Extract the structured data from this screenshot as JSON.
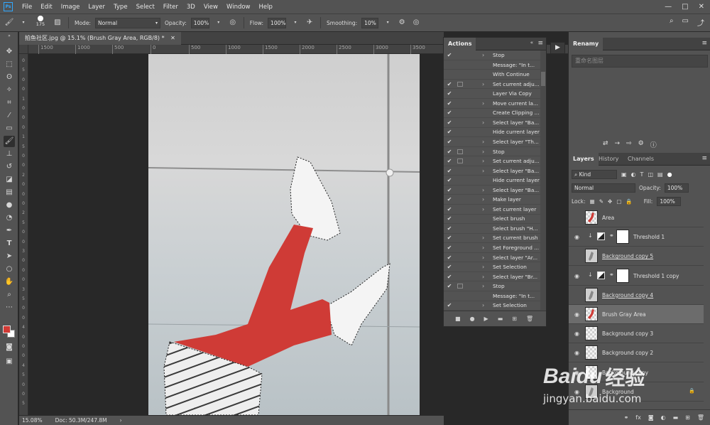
{
  "app": {
    "logo": "Ps"
  },
  "menu": [
    "File",
    "Edit",
    "Image",
    "Layer",
    "Type",
    "Select",
    "Filter",
    "3D",
    "View",
    "Window",
    "Help"
  ],
  "window_controls": {
    "min": "—",
    "max": "□",
    "close": "✕"
  },
  "options_bar": {
    "brush_size": "175",
    "mode_label": "Mode:",
    "mode_value": "Normal",
    "opacity_label": "Opacity:",
    "opacity_value": "100%",
    "flow_label": "Flow:",
    "flow_value": "100%",
    "smoothing_label": "Smoothing:",
    "smoothing_value": "10%"
  },
  "document": {
    "tab_title": "拍鱼社区.jpg @ 15.1% (Brush Gray Area, RGB/8) *",
    "zoom": "15.08%",
    "doc_info": "Doc: 50.3M/247.8M"
  },
  "ruler_h": [
    "1500",
    "1000",
    "500",
    "0",
    "500",
    "1000",
    "1500",
    "2000",
    "2500",
    "3000",
    "3500"
  ],
  "ruler_v": [
    "0",
    "5",
    "0",
    "0",
    "1",
    "0",
    "0",
    "0",
    "1",
    "5",
    "0",
    "0",
    "2",
    "0",
    "0",
    "0",
    "2",
    "5",
    "0",
    "0",
    "3",
    "0",
    "0",
    "0",
    "3",
    "5",
    "0",
    "0",
    "4",
    "0",
    "0",
    "0",
    "4",
    "5",
    "0",
    "0",
    "5"
  ],
  "actions_panel": {
    "title": "Actions",
    "rows": [
      {
        "check": true,
        "dialog": false,
        "arrow": true,
        "label": "Stop"
      },
      {
        "check": false,
        "dialog": false,
        "arrow": false,
        "label": "Message:  \"In t..."
      },
      {
        "check": false,
        "dialog": false,
        "arrow": false,
        "label": "With Continue"
      },
      {
        "check": true,
        "dialog": true,
        "arrow": true,
        "label": "Set current adju..."
      },
      {
        "check": true,
        "dialog": false,
        "arrow": false,
        "label": "Layer Via Copy"
      },
      {
        "check": true,
        "dialog": false,
        "arrow": true,
        "label": "Move current la..."
      },
      {
        "check": true,
        "dialog": false,
        "arrow": false,
        "label": "Create Clipping ..."
      },
      {
        "check": true,
        "dialog": false,
        "arrow": true,
        "label": "Select layer \"Ba..."
      },
      {
        "check": true,
        "dialog": false,
        "arrow": false,
        "label": "Hide current layer"
      },
      {
        "check": true,
        "dialog": false,
        "arrow": true,
        "label": "Select layer \"Th..."
      },
      {
        "check": true,
        "dialog": true,
        "arrow": true,
        "label": "Stop"
      },
      {
        "check": true,
        "dialog": true,
        "arrow": true,
        "label": "Set current adju..."
      },
      {
        "check": true,
        "dialog": false,
        "arrow": true,
        "label": "Select layer \"Ba..."
      },
      {
        "check": true,
        "dialog": false,
        "arrow": false,
        "label": "Hide current layer"
      },
      {
        "check": true,
        "dialog": false,
        "arrow": true,
        "label": "Select layer \"Ba..."
      },
      {
        "check": true,
        "dialog": false,
        "arrow": true,
        "label": "Make layer"
      },
      {
        "check": true,
        "dialog": false,
        "arrow": true,
        "label": "Set current layer"
      },
      {
        "check": true,
        "dialog": false,
        "arrow": false,
        "label": "Select brush"
      },
      {
        "check": true,
        "dialog": false,
        "arrow": false,
        "label": "Select brush \"H..."
      },
      {
        "check": true,
        "dialog": false,
        "arrow": true,
        "label": "Set current brush"
      },
      {
        "check": true,
        "dialog": false,
        "arrow": true,
        "label": "Set Foreground ..."
      },
      {
        "check": true,
        "dialog": false,
        "arrow": true,
        "label": "Select layer \"Ar..."
      },
      {
        "check": true,
        "dialog": false,
        "arrow": true,
        "label": "Set Selection"
      },
      {
        "check": true,
        "dialog": false,
        "arrow": true,
        "label": "Select layer \"Br..."
      },
      {
        "check": true,
        "dialog": true,
        "arrow": true,
        "label": "Stop"
      },
      {
        "check": false,
        "dialog": false,
        "arrow": false,
        "label": "Message:  \"In t..."
      },
      {
        "check": true,
        "dialog": false,
        "arrow": true,
        "label": "Set Selection"
      }
    ]
  },
  "renamy_panel": {
    "title": "Renamy",
    "placeholder": "重命名图层"
  },
  "layers_panel": {
    "tabs": [
      "Layers",
      "History",
      "Channels"
    ],
    "kind": "Kind",
    "blend_mode": "Normal",
    "opacity_label": "Opacity:",
    "opacity_value": "100%",
    "lock_label": "Lock:",
    "fill_label": "Fill:",
    "fill_value": "100%",
    "layers": [
      {
        "name": "Area",
        "eye": false,
        "type": "brush",
        "underline": false,
        "selected": false
      },
      {
        "name": "Threshold 1",
        "eye": true,
        "type": "adjust",
        "underline": false,
        "selected": false
      },
      {
        "name": "Background copy 5",
        "eye": false,
        "type": "pixel",
        "underline": true,
        "selected": false
      },
      {
        "name": "Threshold 1 copy",
        "eye": true,
        "type": "adjust",
        "underline": false,
        "selected": false
      },
      {
        "name": "Background copy 4",
        "eye": false,
        "type": "pixel",
        "underline": true,
        "selected": false
      },
      {
        "name": "Brush Gray Area",
        "eye": true,
        "type": "brush",
        "underline": false,
        "selected": true
      },
      {
        "name": "Background copy 3",
        "eye": true,
        "type": "empty",
        "underline": false,
        "selected": false
      },
      {
        "name": "Background copy 2",
        "eye": true,
        "type": "empty",
        "underline": false,
        "selected": false
      },
      {
        "name": "Background copy",
        "eye": true,
        "type": "empty",
        "underline": false,
        "selected": false
      },
      {
        "name": "Background",
        "eye": true,
        "type": "pixel",
        "underline": false,
        "selected": false
      }
    ]
  },
  "watermark": {
    "brand": "Baidu",
    "brand_cn": "经验",
    "url": "jingyan.baidu.com"
  },
  "colors": {
    "foreground": "#d13a35",
    "background": "#ffffff",
    "accent": "#31a8ff",
    "paint": "#cf3b36"
  }
}
